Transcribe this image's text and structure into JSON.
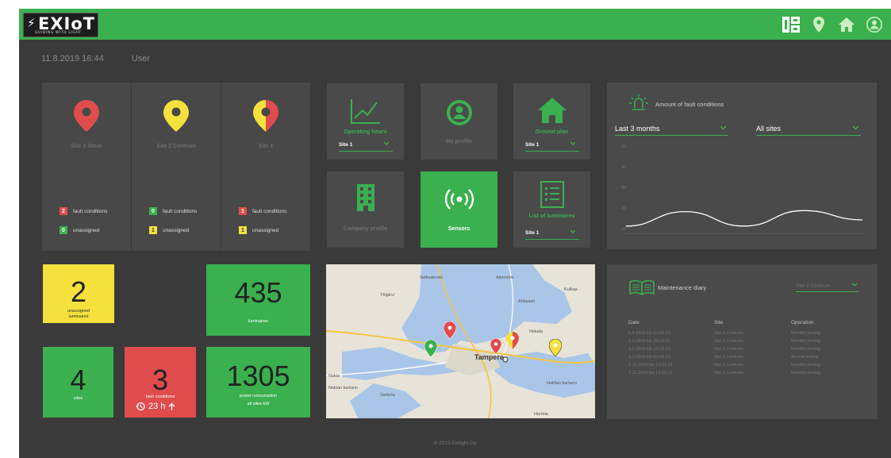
{
  "brand": {
    "bolt": "⚡",
    "name": "EXIoT",
    "tagline": "GUIDING WITH LIGHT"
  },
  "topbar": {
    "icons": [
      "layout-grid-icon",
      "location-pin-icon",
      "home-icon",
      "user-circle-icon"
    ]
  },
  "header": {
    "datetime": "11.8.2019 16:44",
    "user": "User"
  },
  "colors": {
    "green": "#3ab04f",
    "red": "#e04c4c",
    "yellow": "#f4e13c",
    "bg": "#3a3a3a",
    "panel": "#4a4a4a"
  },
  "sites": [
    {
      "name": "Site 3 Store",
      "pin_color": "#e04c4c",
      "fault_count": "2",
      "fault_label": "fault conditions",
      "unassigned_count": "0",
      "unassigned_label": "unassigned"
    },
    {
      "name": "Site 2 Centrum",
      "pin_color": "#f4e13c",
      "fault_count": "0",
      "fault_label": "fault conditions",
      "unassigned_count": "1",
      "unassigned_label": "unassigned"
    },
    {
      "name": "Site 1",
      "pin_color": "split",
      "fault_count": "1",
      "fault_label": "fault conditions",
      "unassigned_count": "1",
      "unassigned_label": "unassigned"
    }
  ],
  "nav": {
    "operating_hours": {
      "label": "Operating hours",
      "select": "Site 1"
    },
    "my_profile": {
      "label": "My profile"
    },
    "ground_plan": {
      "label": "Ground plan",
      "select": "Site 1"
    },
    "company_profile": {
      "label": "Company profile"
    },
    "sensors": {
      "label": "Sensors"
    },
    "list_of_luminaires": {
      "label": "List of luminaires",
      "select": "Site 1"
    }
  },
  "fault_chart": {
    "title": "Amount of fault conditions",
    "period": "Last 3 months",
    "scope": "All sites",
    "chart_data": {
      "type": "line",
      "title": "Amount of fault conditions",
      "ylim": [
        10,
        50
      ],
      "yticks": [
        "50",
        "40",
        "30",
        "20",
        "10"
      ],
      "series": [
        {
          "values": [
            12,
            19,
            12,
            19.5,
            15
          ]
        }
      ]
    }
  },
  "stats": {
    "unassigned": {
      "value": "2",
      "label1": "unassigned",
      "label2": "luminaires"
    },
    "luminaires": {
      "value": "435",
      "label": "luminaires"
    },
    "sites": {
      "value": "4",
      "label": "sites"
    },
    "faults": {
      "value": "3",
      "label": "fault conditions",
      "time": "23 h"
    },
    "power": {
      "value": "1305",
      "label1": "power consumption",
      "label2": "all sites kW"
    }
  },
  "map": {
    "labels": [
      "Valkeakoski",
      "Ylöjärvi",
      "Aitoneimi",
      "Kulkaa",
      "Ahtisaari",
      "Nekala",
      "Nokia",
      "Tampere",
      "Nokian kartano",
      "Sarkola",
      "Hallilan kartano",
      "Hermia"
    ],
    "pins": [
      {
        "color": "#e04c4c"
      },
      {
        "color": "#3ab04f"
      },
      {
        "color": "#e04c4c"
      },
      {
        "color": "split"
      },
      {
        "color": "#f4e13c"
      }
    ]
  },
  "diary": {
    "title": "Maintenance diary",
    "site": "Site 2 Centrum",
    "columns": [
      "Date",
      "Site",
      "Operation"
    ],
    "rows": [
      [
        "5.4.2019 klo 01:56:23",
        "Site 2 Centrum",
        "Monthly testing"
      ],
      [
        "1.3.2019 klo 23:22:21",
        "Site 2 Centrum",
        "Monthly testing"
      ],
      [
        "3.2.2019 klo 13:23:13",
        "Site 2 Centrum",
        "Monthly testing"
      ],
      [
        "3.1.2019 klo 01:56:23",
        "Site 2 Centrum",
        "Annual testing"
      ],
      [
        "1.12.2018 klo 23:22:21",
        "Site 2 Centrum",
        "Monthly testing"
      ],
      [
        "3.11.2018 klo 13:23:13",
        "Site 2 Centrum",
        "Monthly testing"
      ]
    ]
  },
  "footer": "© 2019 Exilight Oy"
}
